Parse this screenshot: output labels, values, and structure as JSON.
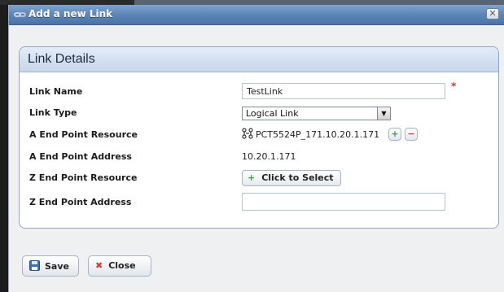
{
  "dialog": {
    "title": "Add a new Link",
    "close_glyph": "✕",
    "title_icon": "link-icon"
  },
  "panel": {
    "title": "Link Details"
  },
  "form": {
    "link_name": {
      "label": "Link Name",
      "value": "TestLink",
      "required_mark": "*"
    },
    "link_type": {
      "label": "Link Type",
      "value": "Logical Link",
      "arrow": "▼"
    },
    "a_resource": {
      "label": "A End Point Resource",
      "value": "PCT5524P_171.10.20.1.171",
      "add_glyph": "+",
      "remove_glyph": "−",
      "icon": "network-device-icon"
    },
    "a_address": {
      "label": "A End Point Address",
      "value": "10.20.1.171"
    },
    "z_resource": {
      "label": "Z End Point Resource",
      "button_label": "Click to Select",
      "add_glyph": "+"
    },
    "z_address": {
      "label": "Z End Point Address",
      "value": ""
    }
  },
  "footer": {
    "save_label": "Save",
    "close_label": "Close",
    "save_icon": "floppy-disk-icon",
    "close_icon": "close-x-icon"
  },
  "colors": {
    "titlebar": "#5d85b8",
    "panel_header": "#c7d6ea",
    "required": "#c0392b",
    "add_green": "#3aa14a",
    "remove_red": "#d63b3b"
  }
}
